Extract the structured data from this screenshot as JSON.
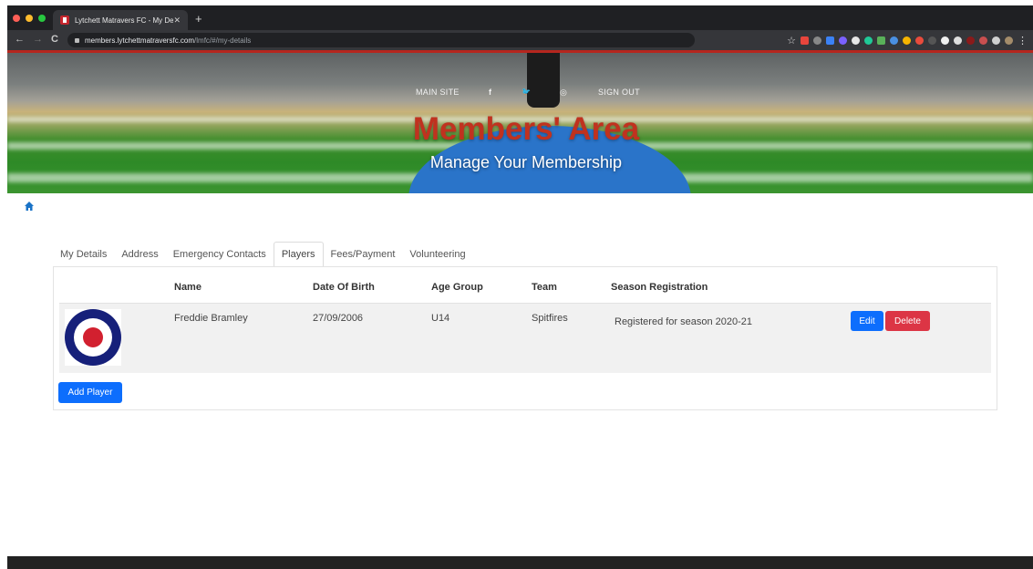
{
  "browser": {
    "tab_title": "Lytchett Matravers FC - My De",
    "tab_close": "✕",
    "new_tab": "+",
    "url_host": "members.lytchettmatraversfc.com",
    "url_path": "/lmfc/#/my-details",
    "back": "←",
    "forward": "→",
    "reload": "C",
    "star": "☆"
  },
  "nav": {
    "main_site": "MAIN SITE",
    "facebook": "f",
    "twitter": "🐦",
    "instagram": "◎",
    "sign_out": "SIGN OUT"
  },
  "hero": {
    "title": "Members' Area",
    "subtitle": "Manage Your Membership"
  },
  "tabs": [
    {
      "label": "My Details"
    },
    {
      "label": "Address"
    },
    {
      "label": "Emergency Contacts"
    },
    {
      "label": "Players",
      "active": true
    },
    {
      "label": "Fees/Payment"
    },
    {
      "label": "Volunteering"
    }
  ],
  "table": {
    "headers": {
      "name": "Name",
      "dob": "Date Of Birth",
      "age_group": "Age Group",
      "team": "Team",
      "season": "Season Registration"
    },
    "rows": [
      {
        "name": "Freddie Bramley",
        "dob": "27/09/2006",
        "age_group": "U14",
        "team": "Spitfires",
        "season": "Registered for season 2020-21",
        "edit_label": "Edit",
        "delete_label": "Delete"
      }
    ]
  },
  "actions": {
    "add_player": "Add Player"
  },
  "colors": {
    "primary": "#0d6efd",
    "danger": "#dc3545",
    "title_red": "#c0321f",
    "roundel_blue": "#16207a",
    "roundel_red": "#d2202f"
  }
}
